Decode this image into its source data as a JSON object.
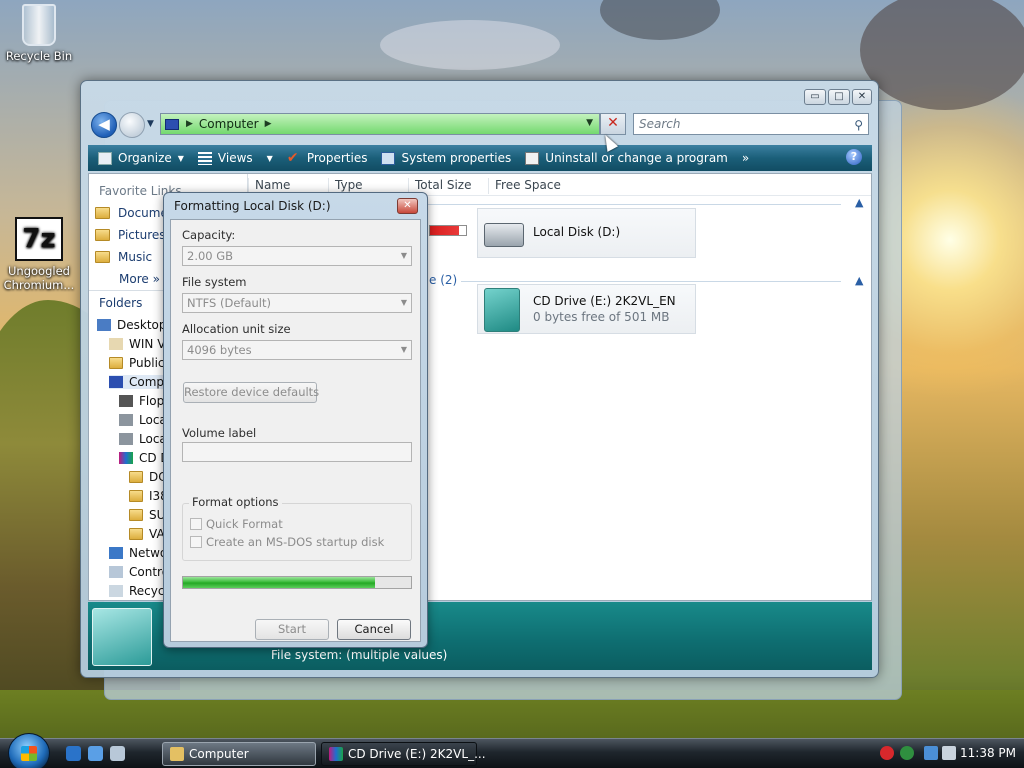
{
  "desktop": {
    "icons": [
      {
        "label": "Recycle Bin",
        "icon": "recycle-bin-icon"
      },
      {
        "label": "Ungoogled Chromium...",
        "icon": "7z-icon",
        "glyph": "7z"
      }
    ]
  },
  "explorer": {
    "window_controls": {
      "minimize": "▭",
      "maximize": "□",
      "close": "✕"
    },
    "address": {
      "crumb": "Computer"
    },
    "search": {
      "placeholder": "Search"
    },
    "commands": [
      "Organize",
      "Views",
      "Properties",
      "System properties",
      "Uninstall or change a program"
    ],
    "commands_more": "»",
    "help": "?",
    "favorites_title": "Favorite Links",
    "favorites": [
      "Documents",
      "Pictures",
      "Music"
    ],
    "favorites_more": "More »",
    "folders_label": "Folders",
    "tree": [
      {
        "label": "Desktop",
        "indent": 0
      },
      {
        "label": "WIN V...",
        "indent": 1
      },
      {
        "label": "Public",
        "indent": 1
      },
      {
        "label": "Computer",
        "indent": 1
      },
      {
        "label": "Floppy",
        "indent": 2
      },
      {
        "label": "Local",
        "indent": 2
      },
      {
        "label": "Local",
        "indent": 2
      },
      {
        "label": "CD Drive",
        "indent": 2
      },
      {
        "label": "DC",
        "indent": 3
      },
      {
        "label": "I38",
        "indent": 3
      },
      {
        "label": "SU",
        "indent": 3
      },
      {
        "label": "VA",
        "indent": 3
      },
      {
        "label": "Network",
        "indent": 1
      },
      {
        "label": "Control",
        "indent": 1
      },
      {
        "label": "Recycle",
        "indent": 1
      }
    ],
    "columns": [
      "Name",
      "Type",
      "Total Size",
      "Free Space"
    ],
    "groups": [
      {
        "label": "",
        "items": [
          {
            "name": "Local Disk (D:)",
            "sub": ""
          }
        ]
      },
      {
        "label": "e (2)",
        "items": [
          {
            "name": "CD Drive (E:) 2K2VL_EN",
            "sub": "0 bytes free of 501 MB"
          }
        ]
      }
    ],
    "details": {
      "file_system": "File system:  (multiple values)"
    }
  },
  "format_dialog": {
    "title": "Formatting Local Disk (D:)",
    "close": "✕",
    "capacity_label": "Capacity:",
    "capacity_value": "2.00 GB",
    "filesystem_label": "File system",
    "filesystem_value": "NTFS (Default)",
    "allocation_label": "Allocation unit size",
    "allocation_value": "4096 bytes",
    "restore_label": "Restore device defaults",
    "volume_label": "Volume label",
    "volume_value": "",
    "format_options_label": "Format options",
    "quick_format_label": "Quick Format",
    "msdos_label": "Create an MS-DOS startup disk",
    "progress": 0.84,
    "start_label": "Start",
    "cancel_label": "Cancel"
  },
  "taskbar": {
    "tasks": [
      {
        "label": "Computer",
        "active": true
      },
      {
        "label": "CD Drive (E:) 2K2VL_...",
        "active": false
      }
    ],
    "clock": "11:38 PM"
  }
}
